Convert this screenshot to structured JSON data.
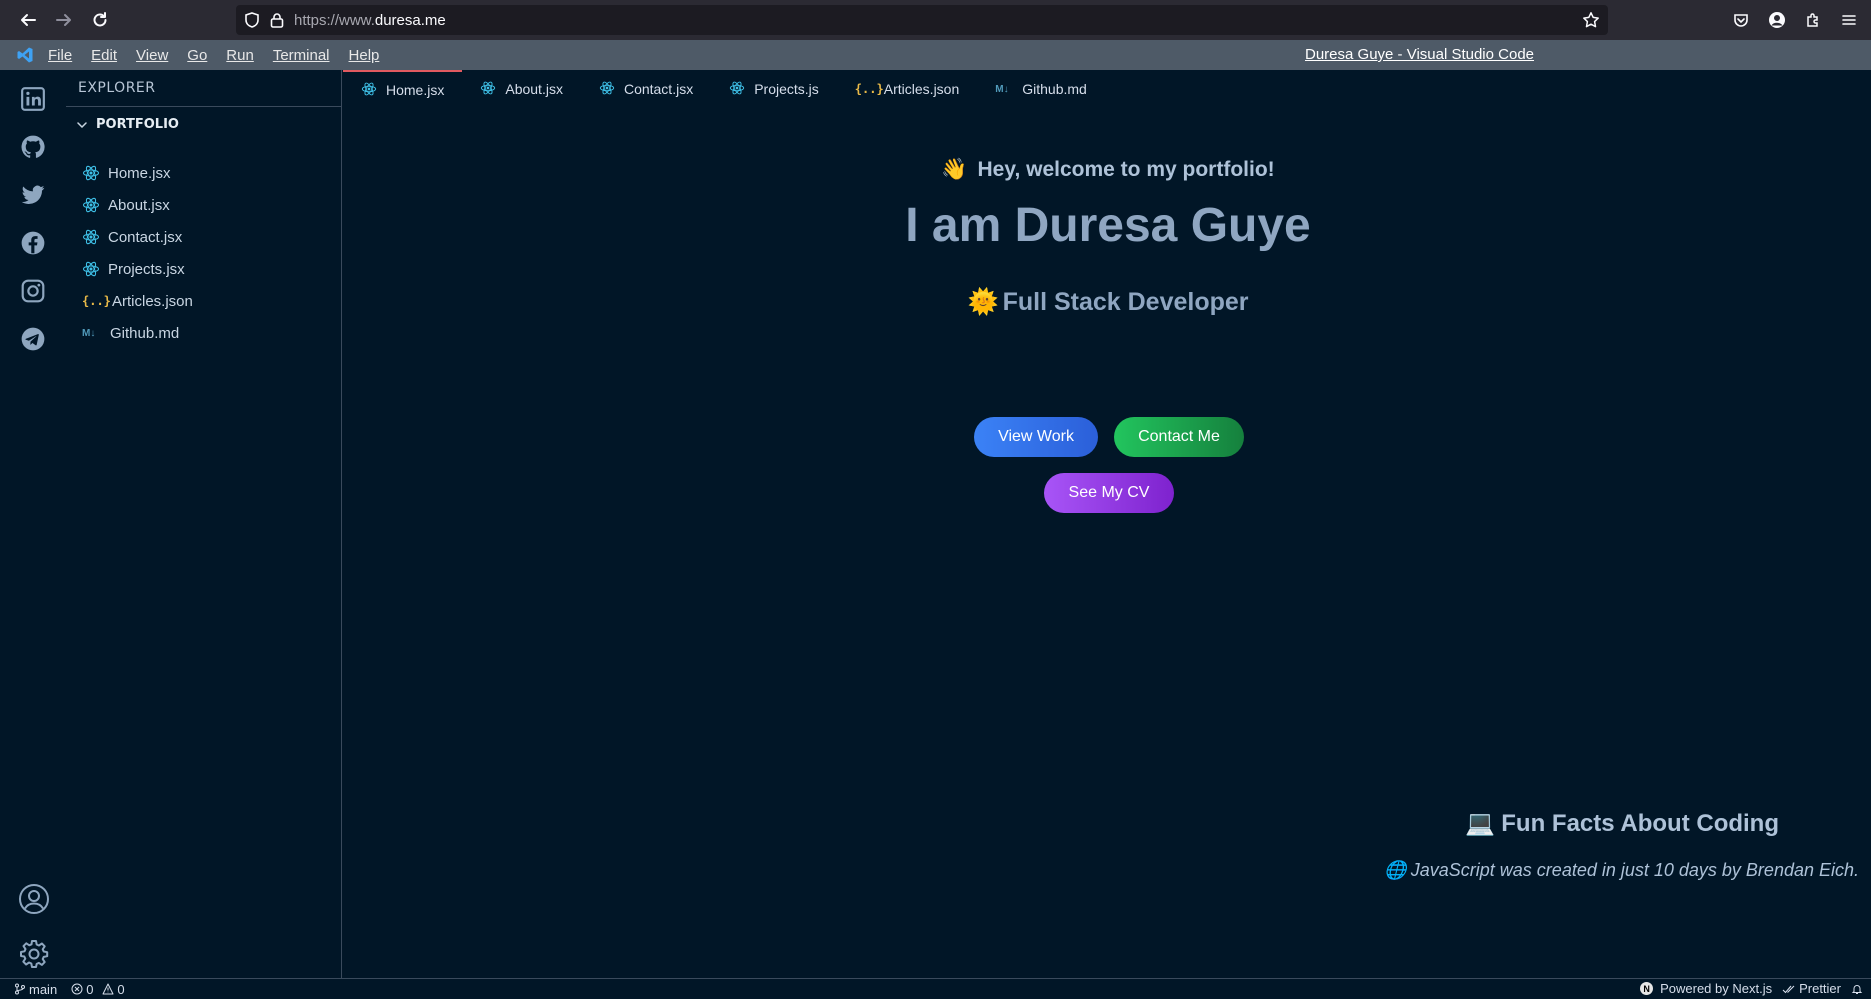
{
  "browser": {
    "url_prefix": "https://www.",
    "url_domain": "duresa.me"
  },
  "menu": {
    "items": [
      "File",
      "Edit",
      "View",
      "Go",
      "Run",
      "Terminal",
      "Help"
    ],
    "window_title": "Duresa Guye - Visual Studio Code"
  },
  "activity": {
    "icons": [
      "linkedin-icon",
      "github-icon",
      "twitter-icon",
      "facebook-icon",
      "instagram-icon",
      "telegram-icon"
    ],
    "bottom_icons": [
      "account-icon",
      "settings-gear-icon"
    ]
  },
  "explorer": {
    "title": "EXPLORER",
    "folder": "PORTFOLIO",
    "files": [
      {
        "name": "Home.jsx",
        "icon": "react-icon"
      },
      {
        "name": "About.jsx",
        "icon": "react-icon"
      },
      {
        "name": "Contact.jsx",
        "icon": "react-icon"
      },
      {
        "name": "Projects.jsx",
        "icon": "react-icon"
      },
      {
        "name": "Articles.json",
        "icon": "json-icon"
      },
      {
        "name": "Github.md",
        "icon": "markdown-icon"
      }
    ]
  },
  "tabs": [
    {
      "name": "Home.jsx",
      "icon": "react-icon",
      "active": true
    },
    {
      "name": "About.jsx",
      "icon": "react-icon",
      "active": false
    },
    {
      "name": "Contact.jsx",
      "icon": "react-icon",
      "active": false
    },
    {
      "name": "Projects.js",
      "icon": "react-icon",
      "active": false
    },
    {
      "name": "Articles.json",
      "icon": "json-icon",
      "active": false
    },
    {
      "name": "Github.md",
      "icon": "markdown-icon",
      "active": false
    }
  ],
  "hero": {
    "wave_emoji": "👋",
    "greeting": "Hey, welcome to my portfolio!",
    "name": "I am Duresa Guye",
    "role_emoji": "🌞",
    "role": "Full Stack Developer",
    "buttons": {
      "view_work": "View Work",
      "contact_me": "Contact Me",
      "see_cv": "See My CV"
    }
  },
  "fun_facts": {
    "title_emoji": "💻",
    "title": "Fun Facts About Coding",
    "fact_emoji": "🌐",
    "fact": "JavaScript was created in just 10 days by Brendan Eich."
  },
  "status": {
    "branch": "main",
    "errors": "0",
    "warnings": "0",
    "powered_by": "Powered by Next.js",
    "nextjs_badge": "N",
    "formatter": "Prettier"
  },
  "colors": {
    "background": "#011627",
    "menu_bar": "#4e5a67",
    "active_tab_border": "#e15a60",
    "react_icon": "#3fc1e8",
    "btn_work": "#3b82f6",
    "btn_contact": "#22c55e",
    "btn_cv": "#a855f7"
  }
}
